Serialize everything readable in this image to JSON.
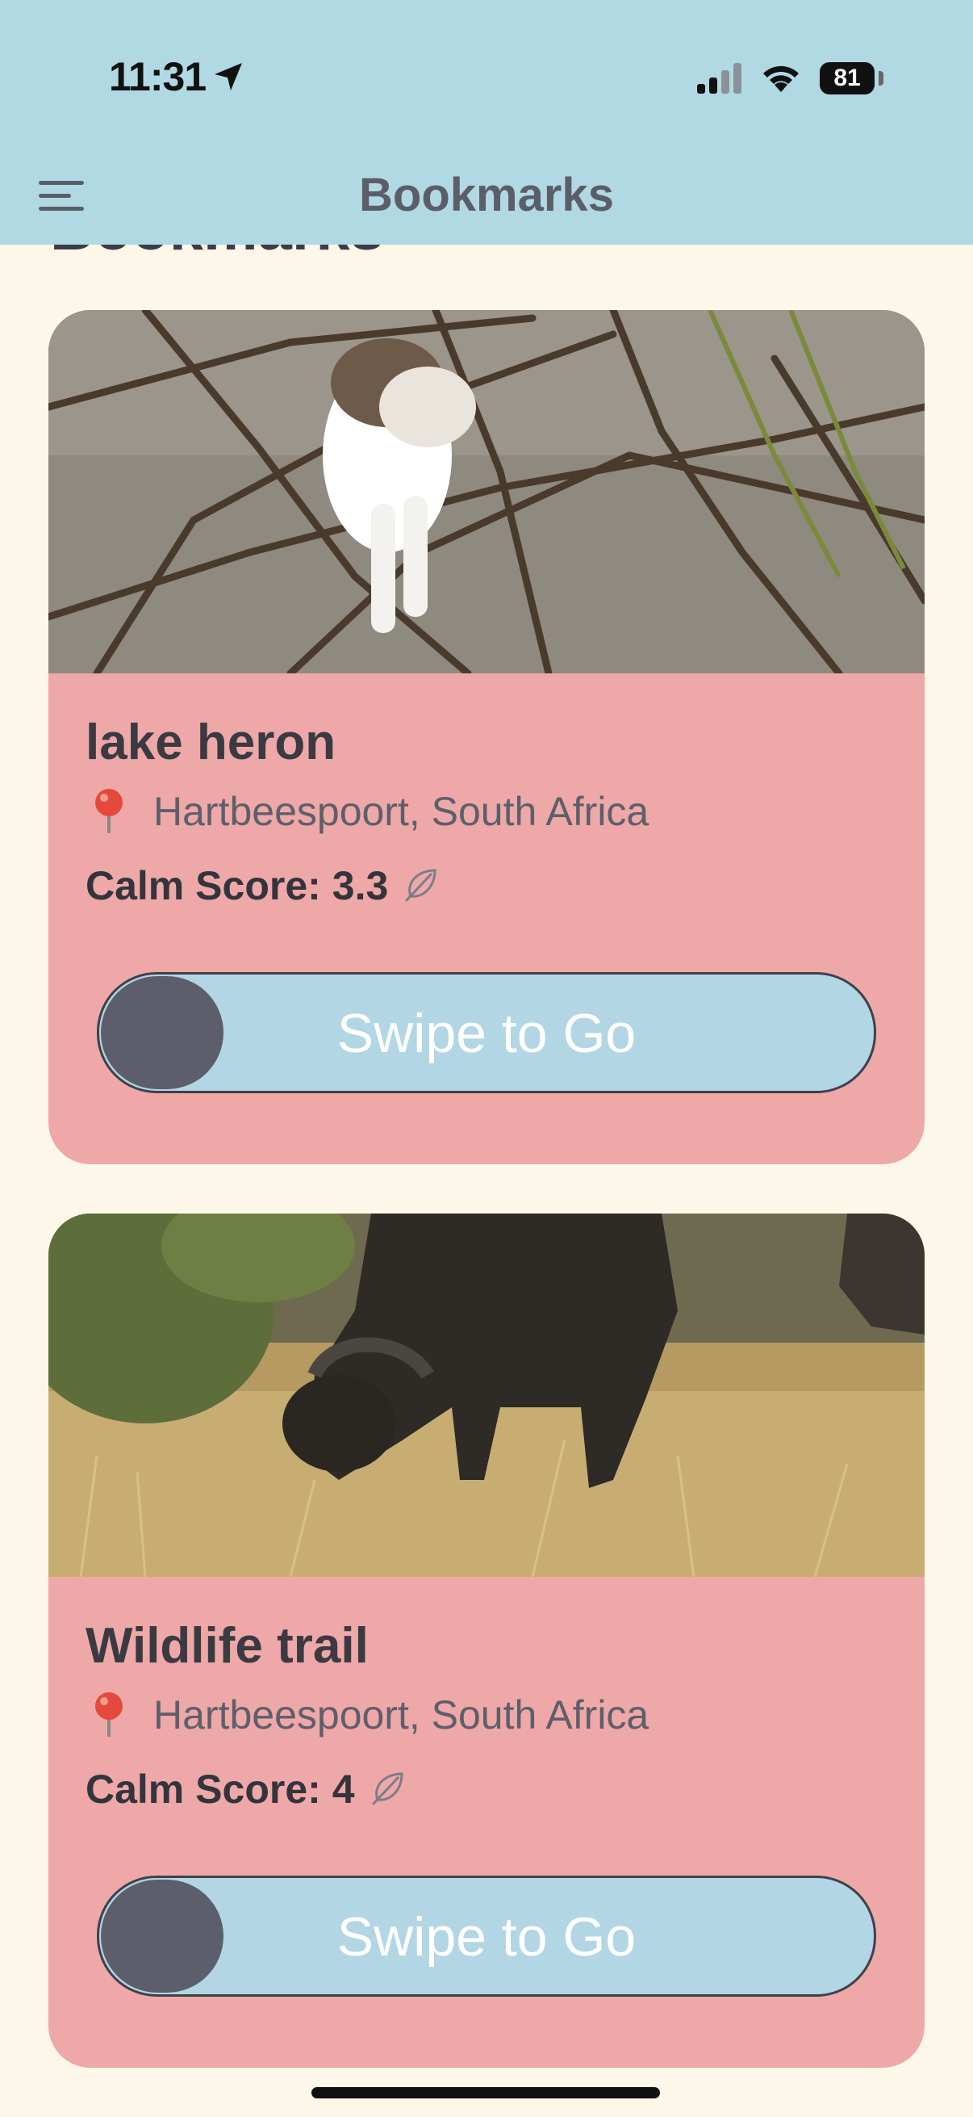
{
  "status_bar": {
    "time": "11:31",
    "battery": "81"
  },
  "header": {
    "title": "Bookmarks",
    "scrolled_title": "Bookmarks"
  },
  "cards": [
    {
      "title": "lake heron",
      "location": "Hartbeespoort, South Africa",
      "calm_label": "Calm Score:",
      "calm_value": "3.3",
      "swipe_label": "Swipe to Go"
    },
    {
      "title": "Wildlife trail",
      "location": "Hartbeespoort, South Africa",
      "calm_label": "Calm Score:",
      "calm_value": "4",
      "swipe_label": "Swipe to Go"
    }
  ]
}
